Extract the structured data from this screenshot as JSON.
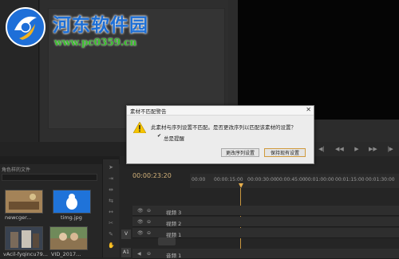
{
  "watermark": {
    "title": "河东软件园",
    "url": "www.pc0359.cn"
  },
  "project": {
    "tabs": [
      "",
      "",
      "",
      ""
    ],
    "path": "角色样的文件",
    "search_placeholder": "",
    "items": [
      {
        "label": "newcger..."
      },
      {
        "label": "timg.jpg"
      },
      {
        "label": "vAcil-fyqincu79..."
      },
      {
        "label": "VID_2017..."
      }
    ]
  },
  "timeline": {
    "timecode": "00:00:23:20",
    "ruler": [
      "00:00",
      "00:00:15:00",
      "00:00:30:00",
      "00:00:45:00",
      "00:01:00:00",
      "00:01:15:00",
      "00:01:30:00"
    ],
    "tracks": [
      {
        "name": "视频 3"
      },
      {
        "name": "视频 2"
      },
      {
        "name": "视频 1"
      },
      {
        "name": "音频 1"
      }
    ],
    "side_labels": [
      "V",
      "A1"
    ]
  },
  "dialog": {
    "title": "素材不匹配警告",
    "close": "✕",
    "message": "此素材与序列设置不匹配。是否更改序列以匹配该素材的设置？",
    "checkbox_checked": true,
    "checkbox_label": "总是提醒",
    "change_button": "更改序列设置",
    "keep_button": "保持现有设置"
  },
  "colors": {
    "accent": "#d3b27a",
    "playhead": "#e8b04e",
    "watermark_blue": "#1d6fd6",
    "watermark_green": "#3bbf2e"
  }
}
